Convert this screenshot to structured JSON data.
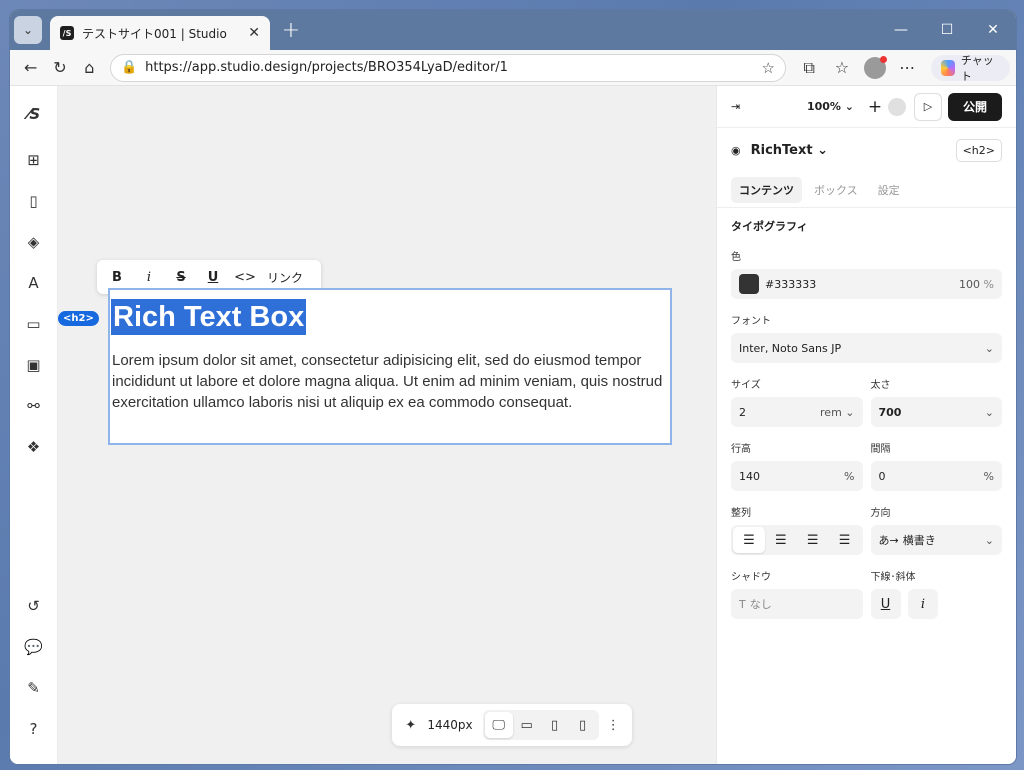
{
  "browser": {
    "tab_title": "テストサイト001 | Studio",
    "url": "https://app.studio.design/projects/BRO354LyaD/editor/1",
    "chat_label": "チャット"
  },
  "canvas": {
    "toolbar": {
      "bold": "B",
      "italic": "i",
      "strike": "S",
      "underline": "U",
      "code": "<>",
      "link": "リンク"
    },
    "tag_badge": "<h2>",
    "heading": "Rich Text Box",
    "body": "Lorem ipsum dolor sit amet, consectetur adipisicing elit, sed do eiusmod tempor incididunt ut labore et dolore magna aliqua. Ut enim ad minim veniam, quis nostrud exercitation ullamco laboris nisi ut aliquip ex ea commodo consequat.",
    "breakpoint": "1440px"
  },
  "panel": {
    "zoom": "100%",
    "publish": "公開",
    "component_name": "RichText",
    "tag": "<h2>",
    "tabs": [
      "コンテンツ",
      "ボックス",
      "設定"
    ],
    "section": "タイポグラフィ",
    "color_label": "色",
    "color_value": "#333333",
    "color_opacity": "100",
    "percent": "%",
    "font_label": "フォント",
    "font_value": "Inter, Noto Sans JP",
    "size_label": "サイズ",
    "size_value": "2",
    "size_unit": "rem",
    "weight_label": "太さ",
    "weight_value": "700",
    "line_height_label": "行高",
    "line_height_value": "140",
    "spacing_label": "間隔",
    "spacing_value": "0",
    "align_label": "整列",
    "direction_label": "方向",
    "direction_value": "横書き",
    "shadow_label": "シャドウ",
    "shadow_value": "なし",
    "deco_label": "下線･斜体"
  },
  "colors": {
    "accent": "#1769e0",
    "publish_bg": "#1b1b1b",
    "text": "#333333"
  }
}
